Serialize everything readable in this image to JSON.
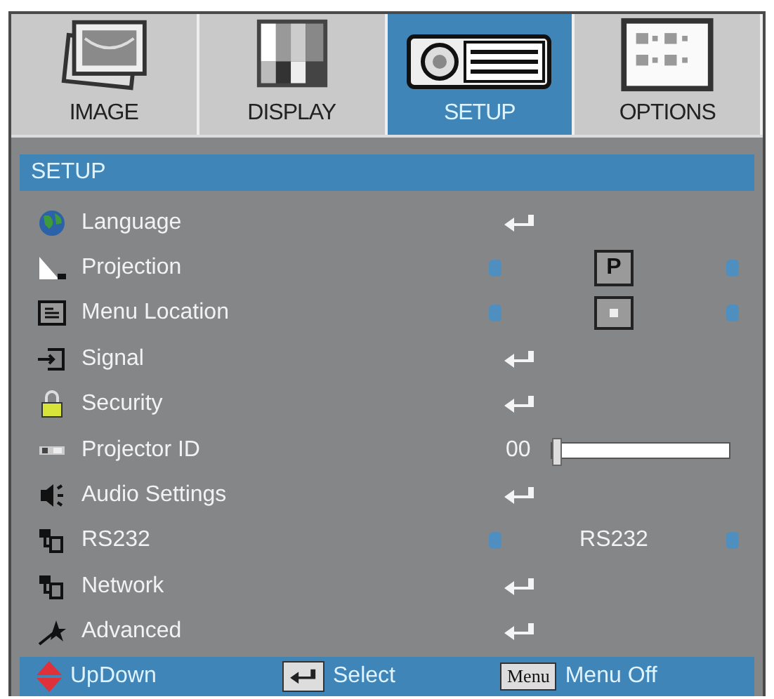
{
  "tabs": [
    {
      "label": "IMAGE",
      "selected": false
    },
    {
      "label": "DISPLAY",
      "selected": false
    },
    {
      "label": "SETUP",
      "selected": true
    },
    {
      "label": "OPTIONS",
      "selected": false
    }
  ],
  "section_title": "SETUP",
  "items": [
    {
      "label": "Language",
      "kind": "enter"
    },
    {
      "label": "Projection",
      "kind": "choice",
      "option": {
        "kind": "boxed-letter",
        "text": "P"
      }
    },
    {
      "label": "Menu Location",
      "kind": "choice",
      "option": {
        "kind": "position-icon"
      }
    },
    {
      "label": "Signal",
      "kind": "enter"
    },
    {
      "label": "Security",
      "kind": "enter"
    },
    {
      "label": "Projector ID",
      "kind": "slider",
      "reading": "00",
      "level": 0.0
    },
    {
      "label": "Audio Settings",
      "kind": "enter"
    },
    {
      "label": "RS232",
      "kind": "choice",
      "option": {
        "kind": "text",
        "text": "RS232"
      }
    },
    {
      "label": "Network",
      "kind": "enter"
    },
    {
      "label": "Advanced",
      "kind": "enter"
    }
  ],
  "footer": [
    {
      "kind": "updown",
      "label": "UpDown"
    },
    {
      "kind": "enter",
      "label": "Select"
    },
    {
      "kind": "menu",
      "key": "Menu",
      "label": "Menu Off"
    }
  ]
}
